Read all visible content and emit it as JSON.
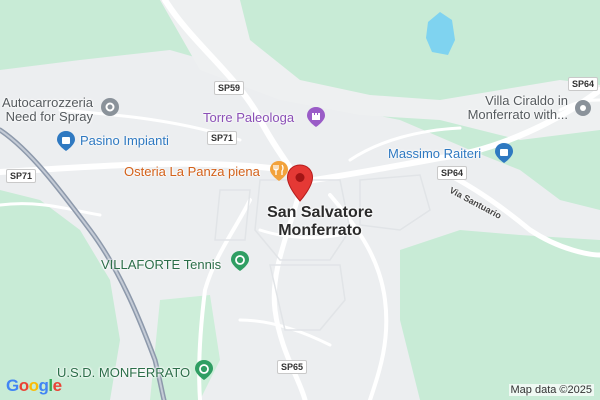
{
  "map": {
    "town": [
      "San Salvatore",
      "Monferrato"
    ],
    "places": {
      "autocarrozzeria": [
        "Autocarrozzeria",
        "Need for Spray"
      ],
      "pasino": "Pasino Impianti",
      "torre": "Torre Paleologa",
      "osteria": "Osteria La Panza piena",
      "massimo": "Massimo Raiteri",
      "villa": [
        "Villa Ciraldo in",
        "Monferrato with..."
      ],
      "villaforte": "VILLAFORTE Tennis",
      "usd": "U.S.D. MONFERRATO"
    },
    "roads": {
      "sp59": "SP59",
      "sp71_a": "SP71",
      "sp71_b": "SP71",
      "sp64_a": "SP64",
      "sp64_b": "SP64",
      "sp65": "SP65",
      "santuario": "Via Santuario"
    },
    "attribution": "Map data ©2025",
    "logo": "Google",
    "colors": {
      "land": "#c8ebd6",
      "urban": "#eceef0",
      "road": "#ffffff",
      "water": "#7fd3f0",
      "pin": "#e53935",
      "blue_poi": "#2f79c1",
      "purple_poi": "#9a5cc7",
      "green_poi": "#2f9e63",
      "orange_poi": "#f2a23c"
    }
  }
}
